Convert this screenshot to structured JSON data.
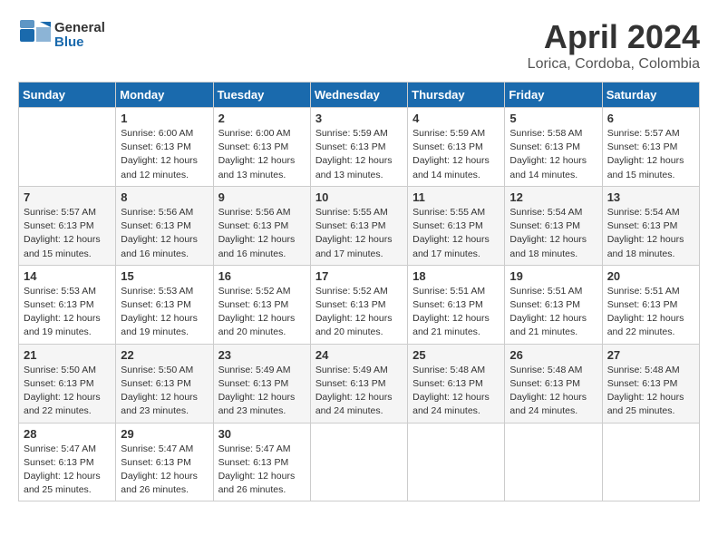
{
  "header": {
    "logo": {
      "general": "General",
      "blue": "Blue"
    },
    "title": "April 2024",
    "location": "Lorica, Cordoba, Colombia"
  },
  "weekdays": [
    "Sunday",
    "Monday",
    "Tuesday",
    "Wednesday",
    "Thursday",
    "Friday",
    "Saturday"
  ],
  "weeks": [
    [
      null,
      {
        "day": "1",
        "sunrise": "6:00 AM",
        "sunset": "6:13 PM",
        "daylight": "12 hours and 12 minutes."
      },
      {
        "day": "2",
        "sunrise": "6:00 AM",
        "sunset": "6:13 PM",
        "daylight": "12 hours and 13 minutes."
      },
      {
        "day": "3",
        "sunrise": "5:59 AM",
        "sunset": "6:13 PM",
        "daylight": "12 hours and 13 minutes."
      },
      {
        "day": "4",
        "sunrise": "5:59 AM",
        "sunset": "6:13 PM",
        "daylight": "12 hours and 14 minutes."
      },
      {
        "day": "5",
        "sunrise": "5:58 AM",
        "sunset": "6:13 PM",
        "daylight": "12 hours and 14 minutes."
      },
      {
        "day": "6",
        "sunrise": "5:57 AM",
        "sunset": "6:13 PM",
        "daylight": "12 hours and 15 minutes."
      }
    ],
    [
      {
        "day": "7",
        "sunrise": "5:57 AM",
        "sunset": "6:13 PM",
        "daylight": "12 hours and 15 minutes."
      },
      {
        "day": "8",
        "sunrise": "5:56 AM",
        "sunset": "6:13 PM",
        "daylight": "12 hours and 16 minutes."
      },
      {
        "day": "9",
        "sunrise": "5:56 AM",
        "sunset": "6:13 PM",
        "daylight": "12 hours and 16 minutes."
      },
      {
        "day": "10",
        "sunrise": "5:55 AM",
        "sunset": "6:13 PM",
        "daylight": "12 hours and 17 minutes."
      },
      {
        "day": "11",
        "sunrise": "5:55 AM",
        "sunset": "6:13 PM",
        "daylight": "12 hours and 17 minutes."
      },
      {
        "day": "12",
        "sunrise": "5:54 AM",
        "sunset": "6:13 PM",
        "daylight": "12 hours and 18 minutes."
      },
      {
        "day": "13",
        "sunrise": "5:54 AM",
        "sunset": "6:13 PM",
        "daylight": "12 hours and 18 minutes."
      }
    ],
    [
      {
        "day": "14",
        "sunrise": "5:53 AM",
        "sunset": "6:13 PM",
        "daylight": "12 hours and 19 minutes."
      },
      {
        "day": "15",
        "sunrise": "5:53 AM",
        "sunset": "6:13 PM",
        "daylight": "12 hours and 19 minutes."
      },
      {
        "day": "16",
        "sunrise": "5:52 AM",
        "sunset": "6:13 PM",
        "daylight": "12 hours and 20 minutes."
      },
      {
        "day": "17",
        "sunrise": "5:52 AM",
        "sunset": "6:13 PM",
        "daylight": "12 hours and 20 minutes."
      },
      {
        "day": "18",
        "sunrise": "5:51 AM",
        "sunset": "6:13 PM",
        "daylight": "12 hours and 21 minutes."
      },
      {
        "day": "19",
        "sunrise": "5:51 AM",
        "sunset": "6:13 PM",
        "daylight": "12 hours and 21 minutes."
      },
      {
        "day": "20",
        "sunrise": "5:51 AM",
        "sunset": "6:13 PM",
        "daylight": "12 hours and 22 minutes."
      }
    ],
    [
      {
        "day": "21",
        "sunrise": "5:50 AM",
        "sunset": "6:13 PM",
        "daylight": "12 hours and 22 minutes."
      },
      {
        "day": "22",
        "sunrise": "5:50 AM",
        "sunset": "6:13 PM",
        "daylight": "12 hours and 23 minutes."
      },
      {
        "day": "23",
        "sunrise": "5:49 AM",
        "sunset": "6:13 PM",
        "daylight": "12 hours and 23 minutes."
      },
      {
        "day": "24",
        "sunrise": "5:49 AM",
        "sunset": "6:13 PM",
        "daylight": "12 hours and 24 minutes."
      },
      {
        "day": "25",
        "sunrise": "5:48 AM",
        "sunset": "6:13 PM",
        "daylight": "12 hours and 24 minutes."
      },
      {
        "day": "26",
        "sunrise": "5:48 AM",
        "sunset": "6:13 PM",
        "daylight": "12 hours and 24 minutes."
      },
      {
        "day": "27",
        "sunrise": "5:48 AM",
        "sunset": "6:13 PM",
        "daylight": "12 hours and 25 minutes."
      }
    ],
    [
      {
        "day": "28",
        "sunrise": "5:47 AM",
        "sunset": "6:13 PM",
        "daylight": "12 hours and 25 minutes."
      },
      {
        "day": "29",
        "sunrise": "5:47 AM",
        "sunset": "6:13 PM",
        "daylight": "12 hours and 26 minutes."
      },
      {
        "day": "30",
        "sunrise": "5:47 AM",
        "sunset": "6:13 PM",
        "daylight": "12 hours and 26 minutes."
      },
      null,
      null,
      null,
      null
    ]
  ],
  "labels": {
    "sunrise": "Sunrise:",
    "sunset": "Sunset:",
    "daylight": "Daylight:"
  }
}
